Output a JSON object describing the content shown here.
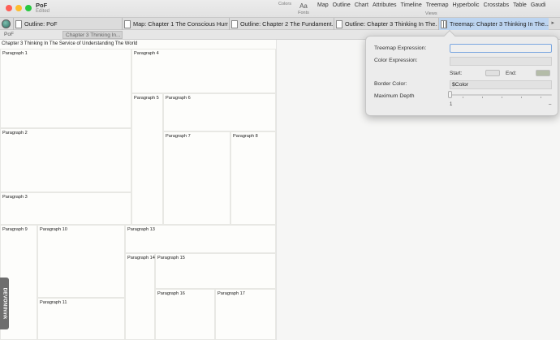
{
  "window": {
    "title": "PoF",
    "subtitle": "Edited"
  },
  "toolbar": {
    "colors_label": "Colors",
    "fonts_label": "Fonts",
    "fonts_glyph": "Aa",
    "views_label": "Views",
    "views": [
      "Map",
      "Outline",
      "Chart",
      "Attributes",
      "Timeline",
      "Treemap",
      "Hyperbolic",
      "Crosstabs",
      "Table",
      "Gaudi"
    ]
  },
  "tabs": [
    {
      "label": "Outline: PoF"
    },
    {
      "label": "Map: Chapter 1 The Conscious Hum..."
    },
    {
      "label": "Outline: Chapter 2 The Fundament..."
    },
    {
      "label": "Outline: Chapter 3 Thinking In The..."
    },
    {
      "label": "Treemap: Chapter 3 Thinking In The...",
      "active": true
    }
  ],
  "tab_more": "▸",
  "breadcrumb": [
    "PoF",
    "Chapter 3 Thinking In..."
  ],
  "treemap": {
    "title": "Chapter 3 Thinking In The Service of Understanding The World",
    "cells": [
      "Paragraph 1",
      "Paragraph 2",
      "Paragraph 3",
      "Paragraph 4",
      "Paragraph 5",
      "Paragraph 6",
      "Paragraph 7",
      "Paragraph 8",
      "Paragraph 9",
      "Paragraph 10",
      "Paragraph 11",
      "Paragraph 13",
      "Paragraph 14",
      "Paragraph 15",
      "Paragraph 16",
      "Paragraph 17"
    ]
  },
  "side_tab": "DEVONthink",
  "popover": {
    "treemap_expression_label": "Treemap Expression:",
    "treemap_expression_value": "",
    "color_expression_label": "Color Expression:",
    "color_expression_value": "",
    "start_label": "Start:",
    "end_label": "End:",
    "start_color": "#e0e0e0",
    "end_color": "#b4bca8",
    "border_color_label": "Border Color:",
    "border_color_value": "$Color",
    "max_depth_label": "Maximum Depth",
    "max_depth_min": "1",
    "max_depth_max": "–",
    "max_depth_value": 1
  },
  "colors": {
    "active_tab": "#bcd4f0",
    "focus_ring": "#7aa6e0"
  }
}
